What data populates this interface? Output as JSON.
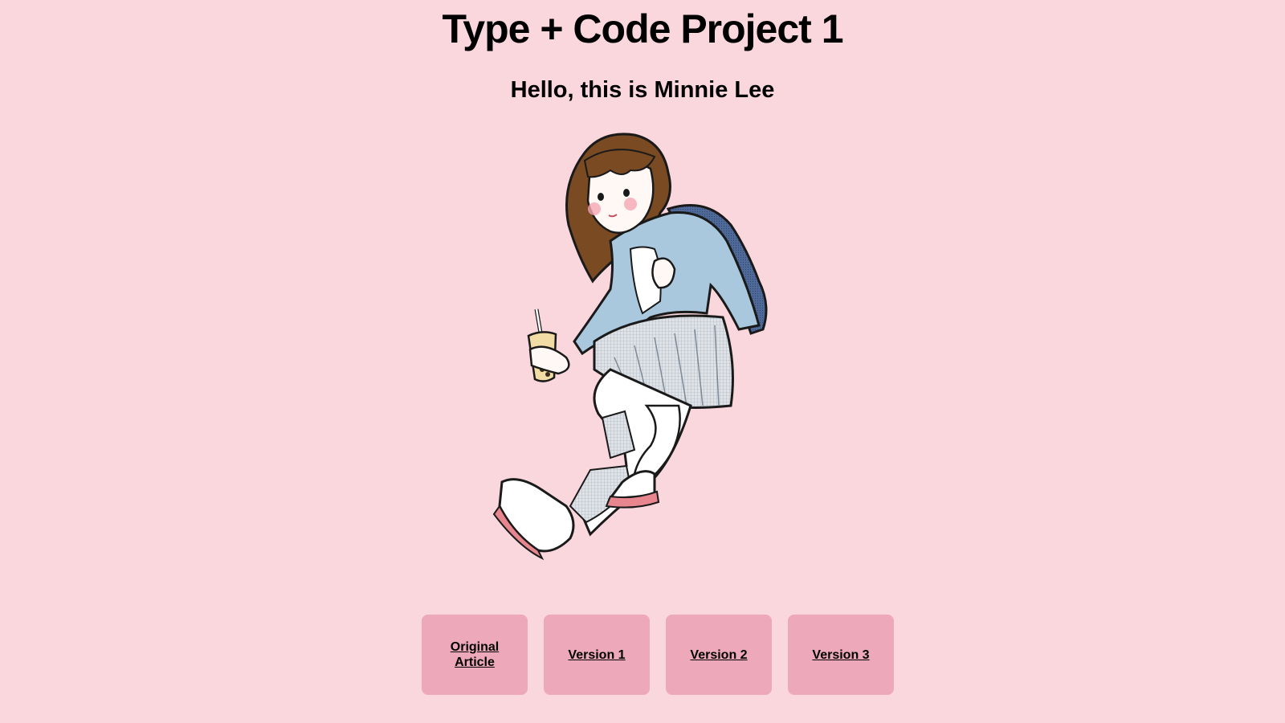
{
  "header": {
    "title": "Type + Code Project 1",
    "subtitle": "Hello, this is Minnie Lee"
  },
  "illustration": {
    "subject": "girl-with-bubble-tea-and-backpack"
  },
  "nav": {
    "items": [
      {
        "label": "Original Article"
      },
      {
        "label": "Version 1"
      },
      {
        "label": "Version 2"
      },
      {
        "label": "Version 3"
      }
    ]
  },
  "colors": {
    "background": "#fad6dd",
    "button": "#eda8b9",
    "text": "#000000"
  }
}
